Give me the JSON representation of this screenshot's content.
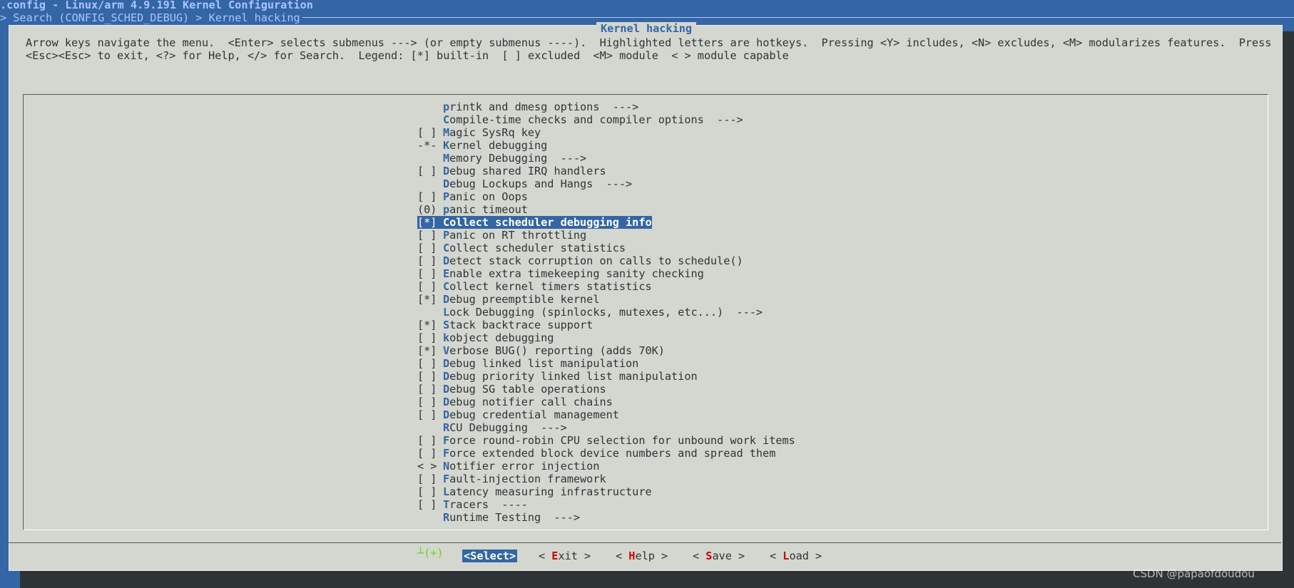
{
  "window": {
    "title": ".config - Linux/arm 4.9.191 Kernel Configuration",
    "breadcrumb": "> Search (CONFIG_SCHED_DEBUG) > Kernel hacking"
  },
  "dialog": {
    "title": "Kernel hacking",
    "help_line1": "Arrow keys navigate the menu.  <Enter> selects submenus ---> (or empty submenus ----).  Highlighted letters are hotkeys.  Pressing <Y> includes, <N> excludes, <M> modularizes features.  Press",
    "help_line2": "<Esc><Esc> to exit, <?> for Help, </> for Search.  Legend: [*] built-in  [ ] excluded  <M> module  < > module capable"
  },
  "menu": {
    "items": [
      {
        "prefix": "",
        "hotkey": "p",
        "rest": "rintk and dmesg options  --->"
      },
      {
        "prefix": "",
        "hotkey": "C",
        "rest": "ompile-time checks and compiler options  --->"
      },
      {
        "prefix": "[ ]",
        "hotkey": "M",
        "rest": "agic SysRq key"
      },
      {
        "prefix": "-*-",
        "hotkey": "K",
        "rest": "ernel debugging"
      },
      {
        "prefix": "",
        "hotkey": "M",
        "rest": "emory Debugging  --->"
      },
      {
        "prefix": "[ ]",
        "hotkey": "D",
        "rest": "ebug shared IRQ handlers"
      },
      {
        "prefix": "",
        "hotkey": "D",
        "rest": "ebug Lockups and Hangs  --->"
      },
      {
        "prefix": "[ ]",
        "hotkey": "P",
        "rest": "anic on Oops"
      },
      {
        "prefix": "(0)",
        "hotkey": "p",
        "rest": "anic timeout"
      },
      {
        "prefix": "[*]",
        "hotkey": "C",
        "rest": "ollect scheduler debugging info",
        "selected": true
      },
      {
        "prefix": "[ ]",
        "hotkey": "P",
        "rest": "anic on RT throttling"
      },
      {
        "prefix": "[ ]",
        "hotkey": "C",
        "rest": "ollect scheduler statistics"
      },
      {
        "prefix": "[ ]",
        "hotkey": "D",
        "rest": "etect stack corruption on calls to schedule()"
      },
      {
        "prefix": "[ ]",
        "hotkey": "E",
        "rest": "nable extra timekeeping sanity checking"
      },
      {
        "prefix": "[ ]",
        "hotkey": "C",
        "rest": "ollect kernel timers statistics"
      },
      {
        "prefix": "[*]",
        "hotkey": "D",
        "rest": "ebug preemptible kernel"
      },
      {
        "prefix": "",
        "hotkey": "L",
        "rest": "ock Debugging (spinlocks, mutexes, etc...)  --->"
      },
      {
        "prefix": "[*]",
        "hotkey": "S",
        "rest": "tack backtrace support"
      },
      {
        "prefix": "[ ]",
        "hotkey": "k",
        "rest": "object debugging"
      },
      {
        "prefix": "[*]",
        "hotkey": "V",
        "rest": "erbose BUG() reporting (adds 70K)"
      },
      {
        "prefix": "[ ]",
        "hotkey": "D",
        "rest": "ebug linked list manipulation"
      },
      {
        "prefix": "[ ]",
        "hotkey": "D",
        "rest": "ebug priority linked list manipulation"
      },
      {
        "prefix": "[ ]",
        "hotkey": "D",
        "rest": "ebug SG table operations"
      },
      {
        "prefix": "[ ]",
        "hotkey": "D",
        "rest": "ebug notifier call chains"
      },
      {
        "prefix": "[ ]",
        "hotkey": "D",
        "rest": "ebug credential management"
      },
      {
        "prefix": "",
        "hotkey": "R",
        "rest": "CU Debugging  --->"
      },
      {
        "prefix": "[ ]",
        "hotkey": "F",
        "rest": "orce round-robin CPU selection for unbound work items"
      },
      {
        "prefix": "[ ]",
        "hotkey": "F",
        "rest": "orce extended block device numbers and spread them"
      },
      {
        "prefix": "< >",
        "hotkey": "N",
        "rest": "otifier error injection"
      },
      {
        "prefix": "[ ]",
        "hotkey": "F",
        "rest": "ault-injection framework"
      },
      {
        "prefix": "[ ]",
        "hotkey": "L",
        "rest": "atency measuring infrastructure"
      },
      {
        "prefix": "[ ]",
        "hotkey": "T",
        "rest": "racers  ----"
      },
      {
        "prefix": "",
        "hotkey": "R",
        "rest": "untime Testing  --->"
      }
    ],
    "more_indicator": "┴(+)"
  },
  "buttons": {
    "select": {
      "pre": "<",
      "hotkey": "S",
      "post": "elect>"
    },
    "exit": {
      "pre": "< ",
      "hotkey": "E",
      "post": "xit >"
    },
    "help": {
      "pre": "< ",
      "hotkey": "H",
      "post": "elp >"
    },
    "save": {
      "pre": "< ",
      "hotkey": "S",
      "post": "ave >"
    },
    "load": {
      "pre": "< ",
      "hotkey": "L",
      "post": "oad >"
    }
  },
  "watermark": "CSDN @papaofdoudou",
  "colors": {
    "background": "#3465a4",
    "dialog": "#d3d7cf",
    "highlight": "#3465a4",
    "hotkey_menu": "#3465a4",
    "hotkey_button": "#cc0000",
    "more_indicator": "#73d216"
  }
}
